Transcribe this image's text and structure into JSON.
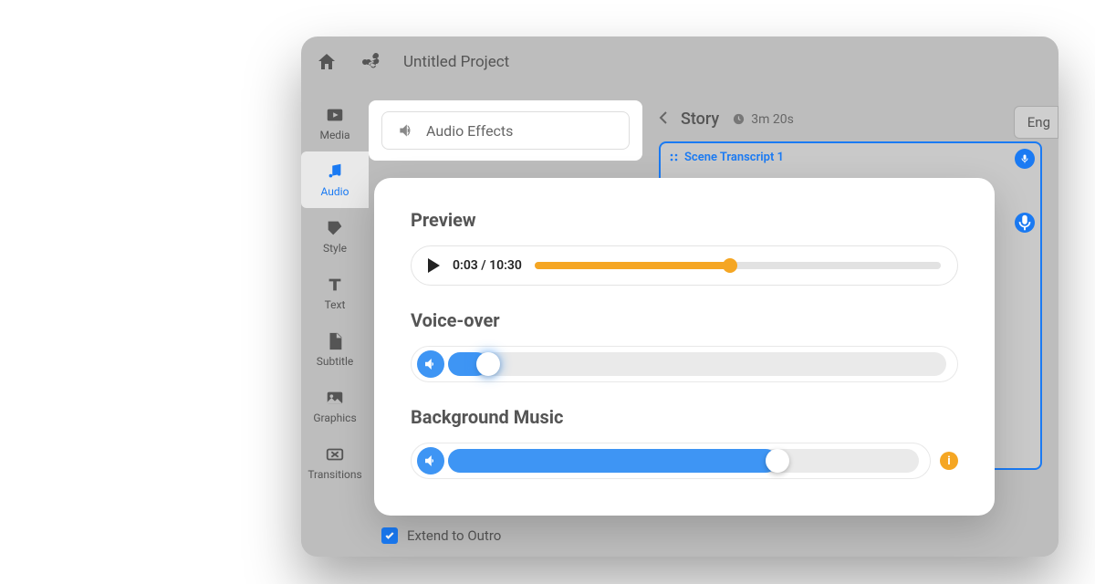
{
  "topbar": {
    "title": "Untitled Project"
  },
  "sidebar": {
    "items": [
      {
        "label": "Media"
      },
      {
        "label": "Audio"
      },
      {
        "label": "Style"
      },
      {
        "label": "Text"
      },
      {
        "label": "Subtitle"
      },
      {
        "label": "Graphics"
      },
      {
        "label": "Transitions"
      }
    ]
  },
  "panel": {
    "audio_effects_label": "Audio Effects"
  },
  "story": {
    "back_label": "Story",
    "duration": "3m 20s",
    "language": "Eng",
    "scene_label": "Scene Transcript 1"
  },
  "extend": {
    "label": "Extend to Outro",
    "checked": true
  },
  "popover": {
    "preview_title": "Preview",
    "time_current": "0:03",
    "time_total": "10:30",
    "time_sep": " / ",
    "progress_pct": 48,
    "voiceover_title": "Voice-over",
    "voiceover_pct": 8,
    "bgm_title": "Background Music",
    "bgm_pct": 70
  }
}
